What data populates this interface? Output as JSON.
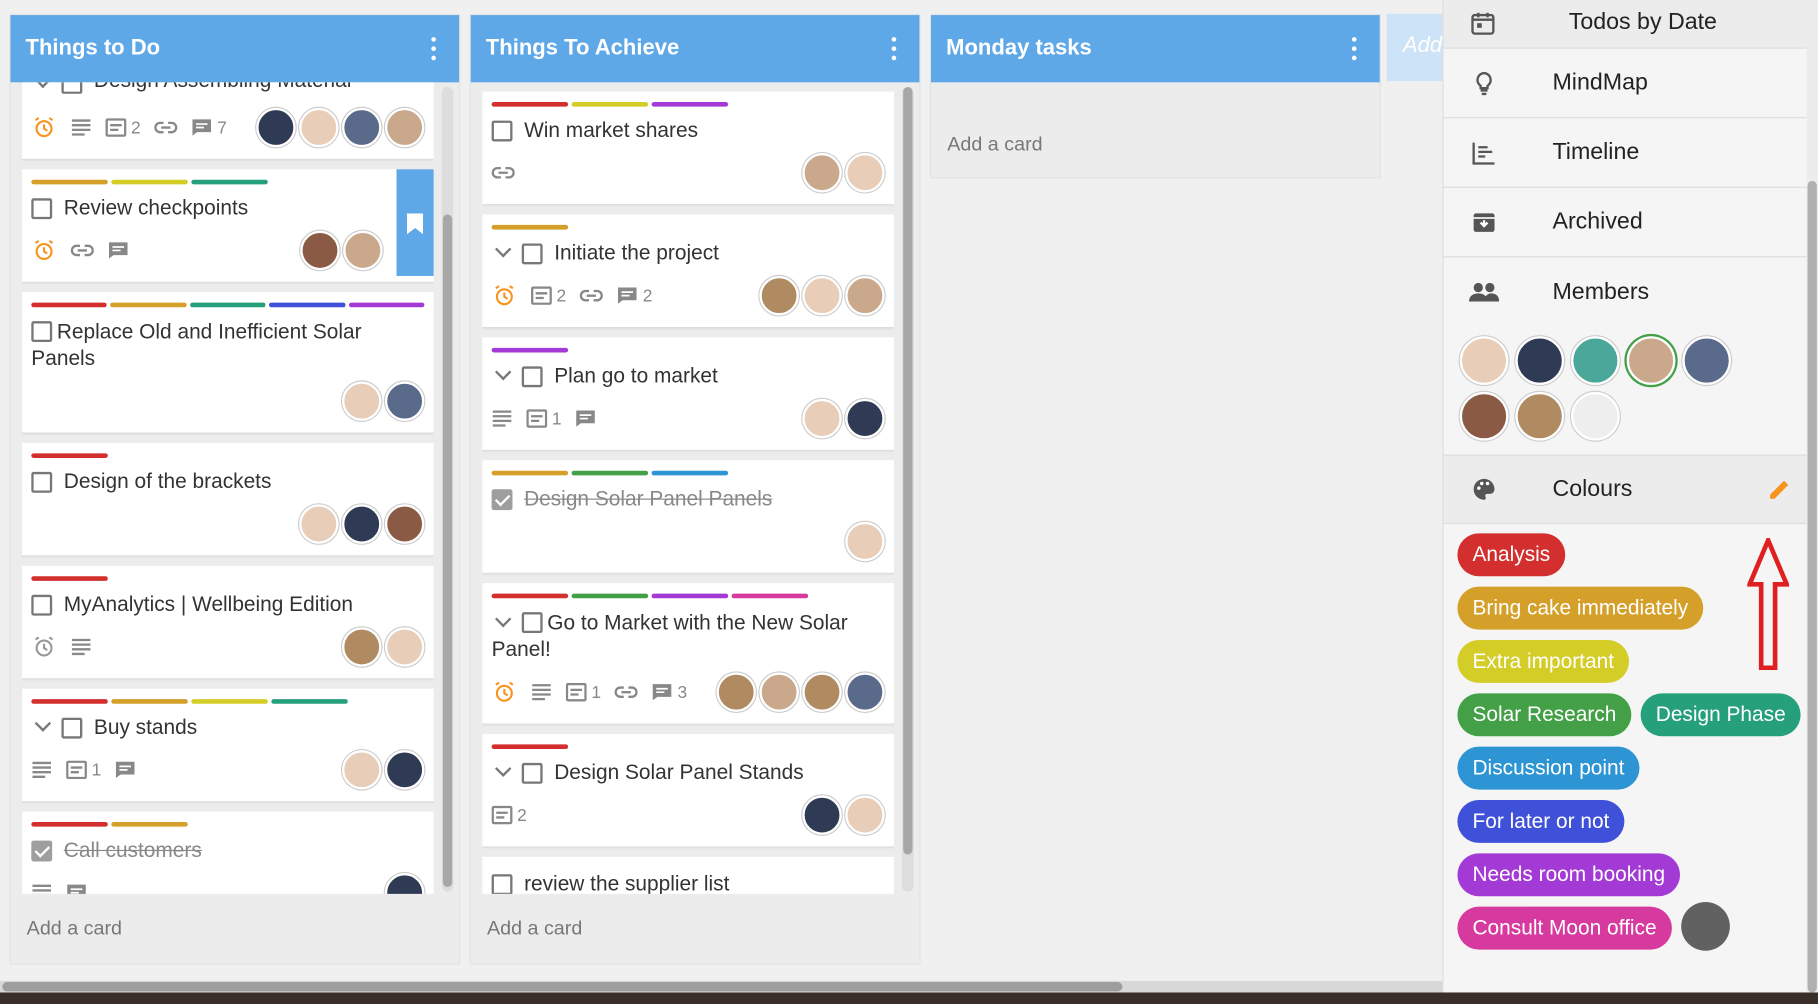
{
  "colors": {
    "header": "#5fa8e8",
    "red": "#d32f2f",
    "orange": "#d4a029",
    "yellow": "#d4cd28",
    "green": "#43a047",
    "teal": "#26a07a",
    "blue": "#2d95d4",
    "indigo": "#3f51d8",
    "purple": "#a43ad6",
    "magenta": "#d63a9e",
    "alarm": "#f7941d"
  },
  "lists": [
    {
      "title": "Things to Do",
      "add_card": "Add a card"
    },
    {
      "title": "Things To Achieve",
      "add_card": "Add a card"
    },
    {
      "title": "Monday tasks",
      "add_card": "Add a card"
    }
  ],
  "ghost_list": "Add",
  "list1": {
    "c0": {
      "title": "Design Assembling Material",
      "desc_count": "2",
      "comments": "7"
    },
    "c1": {
      "title": "Review checkpoints"
    },
    "c2": {
      "title": "Replace Old and Inefficient Solar Panels"
    },
    "c3": {
      "title": "Design of the brackets"
    },
    "c4": {
      "title": "MyAnalytics | Wellbeing Edition"
    },
    "c5": {
      "title": "Buy stands",
      "checklist": "1"
    },
    "c6": {
      "title": "Call customers"
    }
  },
  "list2": {
    "c0": {
      "title": "Win market shares"
    },
    "c1": {
      "title": "Initiate the project",
      "checklist": "2",
      "comments": "2"
    },
    "c2": {
      "title": "Plan go to market",
      "checklist": "1"
    },
    "c3": {
      "title": "Design Solar Panel Panels"
    },
    "c4": {
      "title": "Go to Market with the New Solar Panel!",
      "checklist": "1",
      "comments": "3"
    },
    "c5": {
      "title": "Design Solar Panel Stands",
      "checklist": "2"
    },
    "c6": {
      "title": "review the supplier list"
    }
  },
  "panel": {
    "todos": "Todos by Date",
    "mindmap": "MindMap",
    "timeline": "Timeline",
    "archived": "Archived",
    "members": "Members",
    "colours": "Colours",
    "pills": [
      "Analysis",
      "Bring cake immediately",
      "Extra important",
      "Solar Research",
      "Design Phase",
      "Discussion point",
      "For later or not",
      "Needs room booking",
      "Consult Moon office"
    ]
  }
}
